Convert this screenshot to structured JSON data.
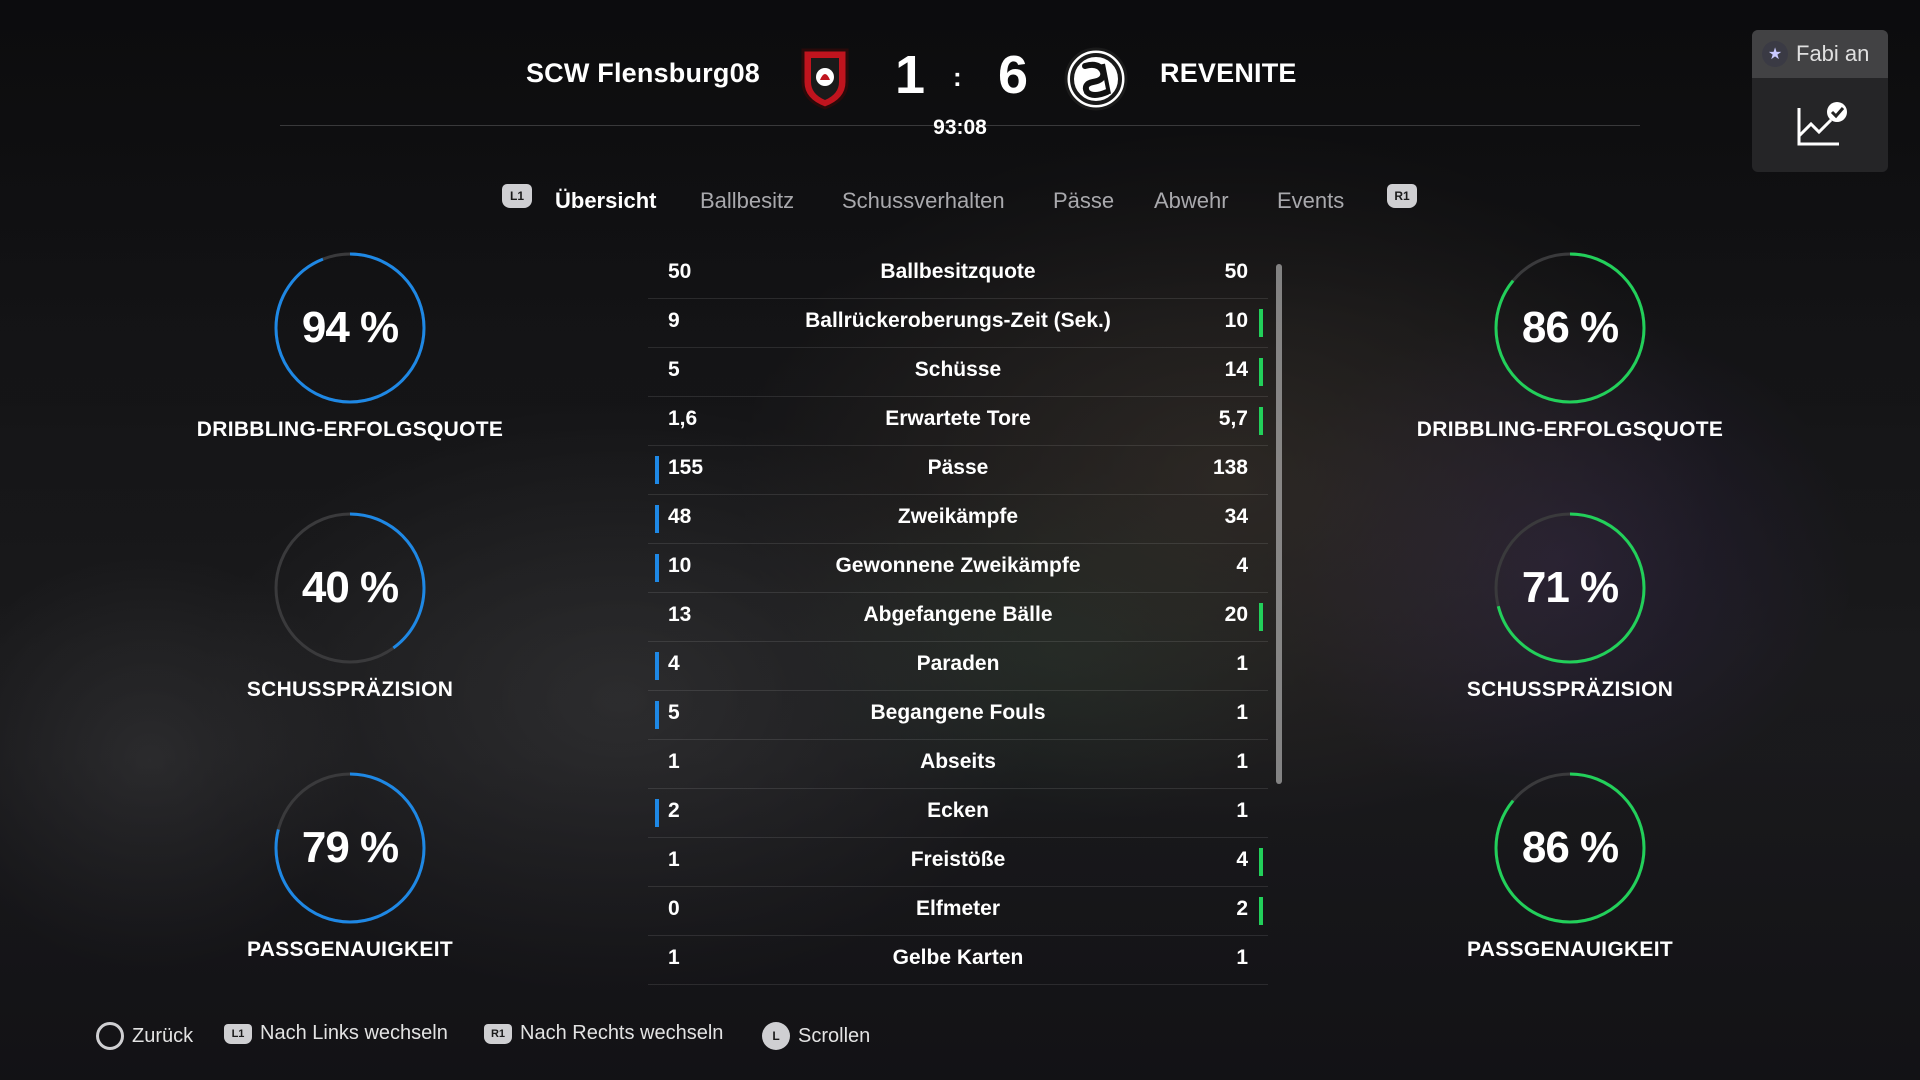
{
  "header": {
    "home_team": "SCW Flensburg08",
    "away_team": "REVENITE",
    "home_score": "1",
    "score_separator": ":",
    "away_score": "6",
    "match_clock": "93:08",
    "home_crest_icon": "red-shield-crest-icon",
    "away_crest_icon": "black-white-round-crest-icon"
  },
  "profile": {
    "name": "Fabi an",
    "icon": "star-badge-icon",
    "action_icon": "performance-chart-check-icon"
  },
  "tabs": {
    "prev_button": "L1",
    "next_button": "R1",
    "items": [
      "Übersicht",
      "Ballbesitz",
      "Schussverhalten",
      "Pässe",
      "Abwehr",
      "Events"
    ],
    "active_index": 0
  },
  "gauges": {
    "home": [
      {
        "value": "94 %",
        "percent": 94,
        "label": "DRIBBLING-ERFOLGSQUOTE"
      },
      {
        "value": "40 %",
        "percent": 40,
        "label": "SCHUSSPRÄZISION"
      },
      {
        "value": "79 %",
        "percent": 79,
        "label": "PASSGENAUIGKEIT"
      }
    ],
    "away": [
      {
        "value": "86 %",
        "percent": 86,
        "label": "DRIBBLING-ERFOLGSQUOTE"
      },
      {
        "value": "71 %",
        "percent": 71,
        "label": "SCHUSSPRÄZISION"
      },
      {
        "value": "86 %",
        "percent": 86,
        "label": "PASSGENAUIGKEIT"
      }
    ]
  },
  "stats": {
    "rows": [
      {
        "home": "50",
        "label": "Ballbesitzquote",
        "away": "50",
        "leader": "none"
      },
      {
        "home": "9",
        "label": "Ballrückeroberungs-Zeit (Sek.)",
        "away": "10",
        "leader": "away"
      },
      {
        "home": "5",
        "label": "Schüsse",
        "away": "14",
        "leader": "away"
      },
      {
        "home": "1,6",
        "label": "Erwartete Tore",
        "away": "5,7",
        "leader": "away"
      },
      {
        "home": "155",
        "label": "Pässe",
        "away": "138",
        "leader": "home"
      },
      {
        "home": "48",
        "label": "Zweikämpfe",
        "away": "34",
        "leader": "home"
      },
      {
        "home": "10",
        "label": "Gewonnene Zweikämpfe",
        "away": "4",
        "leader": "home"
      },
      {
        "home": "13",
        "label": "Abgefangene Bälle",
        "away": "20",
        "leader": "away"
      },
      {
        "home": "4",
        "label": "Paraden",
        "away": "1",
        "leader": "home"
      },
      {
        "home": "5",
        "label": "Begangene Fouls",
        "away": "1",
        "leader": "home"
      },
      {
        "home": "1",
        "label": "Abseits",
        "away": "1",
        "leader": "none"
      },
      {
        "home": "2",
        "label": "Ecken",
        "away": "1",
        "leader": "home"
      },
      {
        "home": "1",
        "label": "Freistöße",
        "away": "4",
        "leader": "away"
      },
      {
        "home": "0",
        "label": "Elfmeter",
        "away": "2",
        "leader": "away"
      },
      {
        "home": "1",
        "label": "Gelbe Karten",
        "away": "1",
        "leader": "none"
      }
    ]
  },
  "footer": {
    "back": {
      "button": "circle-button-icon",
      "label": "Zurück"
    },
    "left": {
      "button": "L1",
      "label": "Nach Links wechseln"
    },
    "right": {
      "button": "R1",
      "label": "Nach Rechts wechseln"
    },
    "scroll": {
      "button": "L",
      "label": "Scrollen"
    }
  },
  "colors": {
    "home_accent": "#1e88e5",
    "away_accent": "#22d05a",
    "gauge_track": "#3a3a3c"
  }
}
